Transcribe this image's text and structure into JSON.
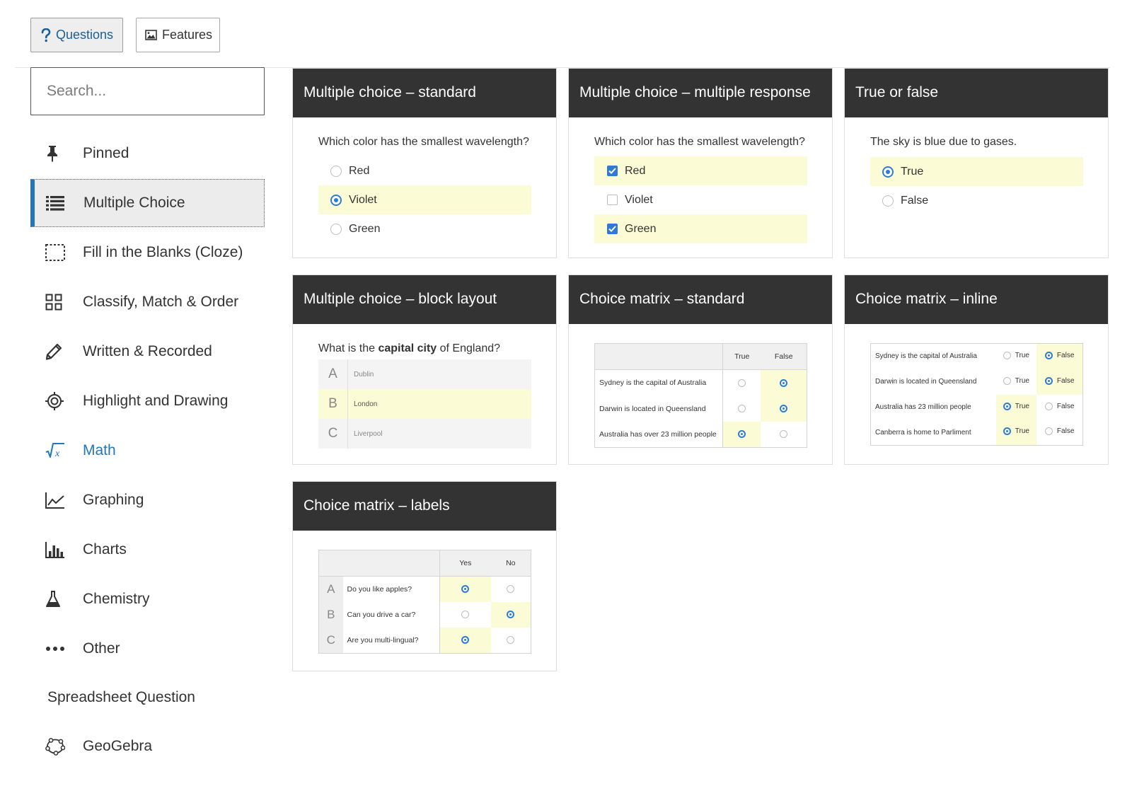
{
  "toolbar": {
    "questions_label": "Questions",
    "features_label": "Features"
  },
  "search": {
    "placeholder": "Search..."
  },
  "sidebar": {
    "items": [
      {
        "label": "Pinned",
        "icon": "pin-icon"
      },
      {
        "label": "Multiple Choice",
        "icon": "list-icon",
        "active": true
      },
      {
        "label": "Fill in the Blanks (Cloze)",
        "icon": "dotted-box-icon"
      },
      {
        "label": "Classify, Match & Order",
        "icon": "grid-icon"
      },
      {
        "label": "Written & Recorded",
        "icon": "pencil-icon"
      },
      {
        "label": "Highlight and Drawing",
        "icon": "target-icon"
      },
      {
        "label": "Math",
        "icon": "sqrt-x-icon",
        "color": "#2277b9"
      },
      {
        "label": "Graphing",
        "icon": "line-graph-icon"
      },
      {
        "label": "Charts",
        "icon": "bar-chart-icon"
      },
      {
        "label": "Chemistry",
        "icon": "flask-icon"
      },
      {
        "label": "Other",
        "icon": "ellipsis-icon"
      },
      {
        "label": "Spreadsheet Question",
        "icon": ""
      },
      {
        "label": "GeoGebra",
        "icon": "geogebra-icon"
      }
    ]
  },
  "colors": {
    "accent": "#2277b9",
    "selected": "#fbfbd5",
    "header": "#333333",
    "radio": "#2e7ad6"
  },
  "cards": {
    "mc_standard": {
      "title": "Multiple choice – standard",
      "question": "Which color has the smallest wavelength?",
      "options": [
        "Red",
        "Violet",
        "Green"
      ],
      "selected": "Violet"
    },
    "mc_multiple": {
      "title": "Multiple choice – multiple response",
      "question": "Which color has the smallest wavelength?",
      "options": [
        "Red",
        "Violet",
        "Green"
      ],
      "selected": [
        "Red",
        "Green"
      ]
    },
    "true_false": {
      "title": "True or false",
      "question": "The sky is blue due to gases.",
      "options": [
        "True",
        "False"
      ],
      "selected": "True"
    },
    "mc_block": {
      "title": "Multiple choice – block layout",
      "question_pre": "What is the ",
      "question_bold": "capital city",
      "question_post": " of England?",
      "options": [
        {
          "letter": "A",
          "text": "Dublin"
        },
        {
          "letter": "B",
          "text": "London"
        },
        {
          "letter": "C",
          "text": "Liverpool"
        }
      ],
      "selected": "B"
    },
    "matrix_standard": {
      "title": "Choice matrix – standard",
      "columns": [
        "True",
        "False"
      ],
      "rows": [
        {
          "text": "Sydney is the capital of Australia",
          "answer": "False"
        },
        {
          "text": "Darwin is located in Queensland",
          "answer": "False"
        },
        {
          "text": "Australia has over 23 million people",
          "answer": "True"
        }
      ]
    },
    "matrix_inline": {
      "title": "Choice matrix – inline",
      "options": [
        "True",
        "False"
      ],
      "rows": [
        {
          "text": "Sydney is the capital of Australia",
          "answer": "False"
        },
        {
          "text": "Darwin is located in Queensland",
          "answer": "False"
        },
        {
          "text": "Australia has 23 million people",
          "answer": "True"
        },
        {
          "text": "Canberra is home to Parliment",
          "answer": "True"
        }
      ]
    },
    "matrix_labels": {
      "title": "Choice matrix – labels",
      "columns": [
        "Yes",
        "No"
      ],
      "rows": [
        {
          "letter": "A",
          "text": "Do you like apples?",
          "answer": "Yes"
        },
        {
          "letter": "B",
          "text": "Can you drive a car?",
          "answer": "No"
        },
        {
          "letter": "C",
          "text": "Are you multi-lingual?",
          "answer": "Yes"
        }
      ]
    }
  }
}
